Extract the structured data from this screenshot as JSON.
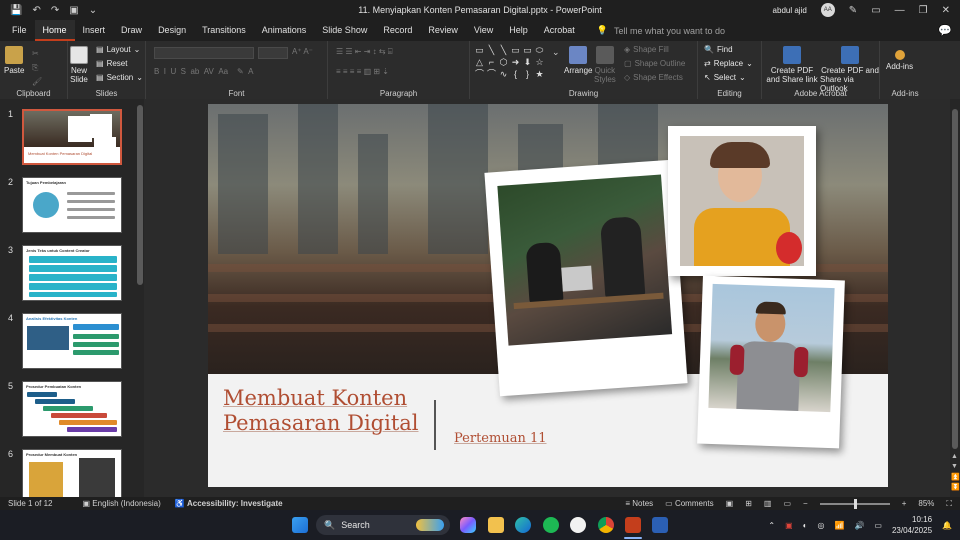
{
  "window": {
    "title": "11. Menyiapkan Konten Pemasaran Digital.pptx  -  PowerPoint",
    "user_name": "abdul ajid",
    "user_initials": "AA"
  },
  "tabs": [
    "File",
    "Home",
    "Insert",
    "Draw",
    "Design",
    "Transitions",
    "Animations",
    "Slide Show",
    "Record",
    "Review",
    "View",
    "Help",
    "Acrobat"
  ],
  "active_tab": "Home",
  "tell_me_placeholder": "Tell me what you want to do",
  "ribbon": {
    "clipboard": {
      "label": "Clipboard",
      "paste": "Paste"
    },
    "slides": {
      "label": "Slides",
      "new_slide": "New",
      "new_slide2": "Slide",
      "layout": "Layout",
      "reset": "Reset",
      "section": "Section"
    },
    "font": {
      "label": "Font"
    },
    "paragraph": {
      "label": "Paragraph"
    },
    "drawing": {
      "label": "Drawing",
      "arrange": "Arrange",
      "quick_styles": "Quick",
      "quick_styles2": "Styles",
      "shape_fill": "Shape Fill",
      "shape_outline": "Shape Outline",
      "shape_effects": "Shape Effects"
    },
    "editing": {
      "label": "Editing",
      "find": "Find",
      "replace": "Replace",
      "select": "Select"
    },
    "acrobat": {
      "label": "Adobe Acrobat",
      "create_pdf": "Create PDF",
      "create_pdf2": "and Share link",
      "create_pdf_outlook": "Create PDF and",
      "create_pdf_outlook2": "Share via Outlook"
    },
    "addins": {
      "label": "Add-ins",
      "addins": "Add-ins"
    }
  },
  "thumbnails": [
    {
      "num": "1",
      "title": "Membuat Konten Pemasaran Digital"
    },
    {
      "num": "2",
      "title": "Tujuan Pembelajaran"
    },
    {
      "num": "3",
      "title": "Jenis Teks untuk Content Creator"
    },
    {
      "num": "4",
      "title": "Analisis Efektivitas Konten"
    },
    {
      "num": "5",
      "title": "Prosedur Pembuatan Konten"
    },
    {
      "num": "6",
      "title": "Prosedur Membuat Konten"
    }
  ],
  "slide": {
    "title_line1": "Membuat Konten",
    "title_line2": "Pemasaran Digital",
    "subtitle": "Pertemuan 11"
  },
  "status": {
    "slide_info": "Slide 1 of 12",
    "language": "English (Indonesia)",
    "accessibility": "Accessibility: Investigate",
    "notes": "Notes",
    "comments": "Comments",
    "zoom": "85%"
  },
  "taskbar": {
    "search": "Search",
    "time": "10:16",
    "date": "23/04/2025"
  }
}
